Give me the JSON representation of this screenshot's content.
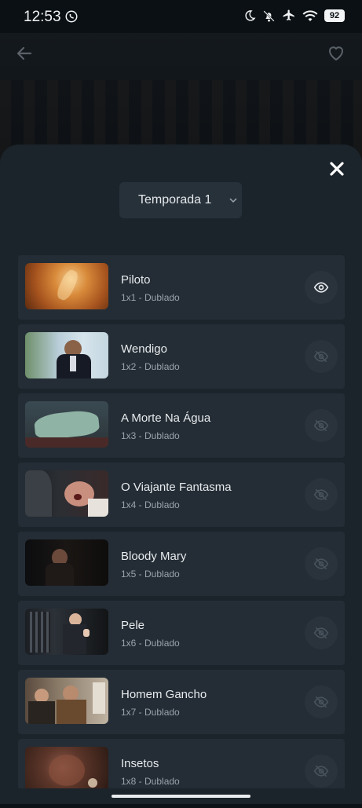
{
  "status_bar": {
    "time": "12:53",
    "left_icons": [
      "whatsapp-icon"
    ],
    "right_icons": [
      "moon-icon",
      "bell-off-icon",
      "airplane-icon",
      "wifi-icon"
    ],
    "battery": "92"
  },
  "header": {
    "back_icon": "arrow-left-icon",
    "favorite_icon": "heart-outline-icon"
  },
  "sheet": {
    "close_icon": "close-icon",
    "season_select": {
      "selected": "Temporada 1",
      "icon": "chevron-down-icon"
    },
    "episodes": [
      {
        "title": "Piloto",
        "subtitle": "1x1 - Dublado",
        "watched": true
      },
      {
        "title": "Wendigo",
        "subtitle": "1x2 - Dublado",
        "watched": false
      },
      {
        "title": "A Morte Na Água",
        "subtitle": "1x3 - Dublado",
        "watched": false
      },
      {
        "title": "O Viajante Fantasma",
        "subtitle": "1x4 - Dublado",
        "watched": false
      },
      {
        "title": "Bloody Mary",
        "subtitle": "1x5 - Dublado",
        "watched": false
      },
      {
        "title": "Pele",
        "subtitle": "1x6 - Dublado",
        "watched": false
      },
      {
        "title": "Homem Gancho",
        "subtitle": "1x7 - Dublado",
        "watched": false
      },
      {
        "title": "Insetos",
        "subtitle": "1x8 - Dublado",
        "watched": false
      }
    ]
  },
  "colors": {
    "background": "#0d1216",
    "sheet": "#1c242b",
    "card": "#242d35",
    "text_primary": "#e8ebee",
    "text_secondary": "#9aa3ab"
  }
}
